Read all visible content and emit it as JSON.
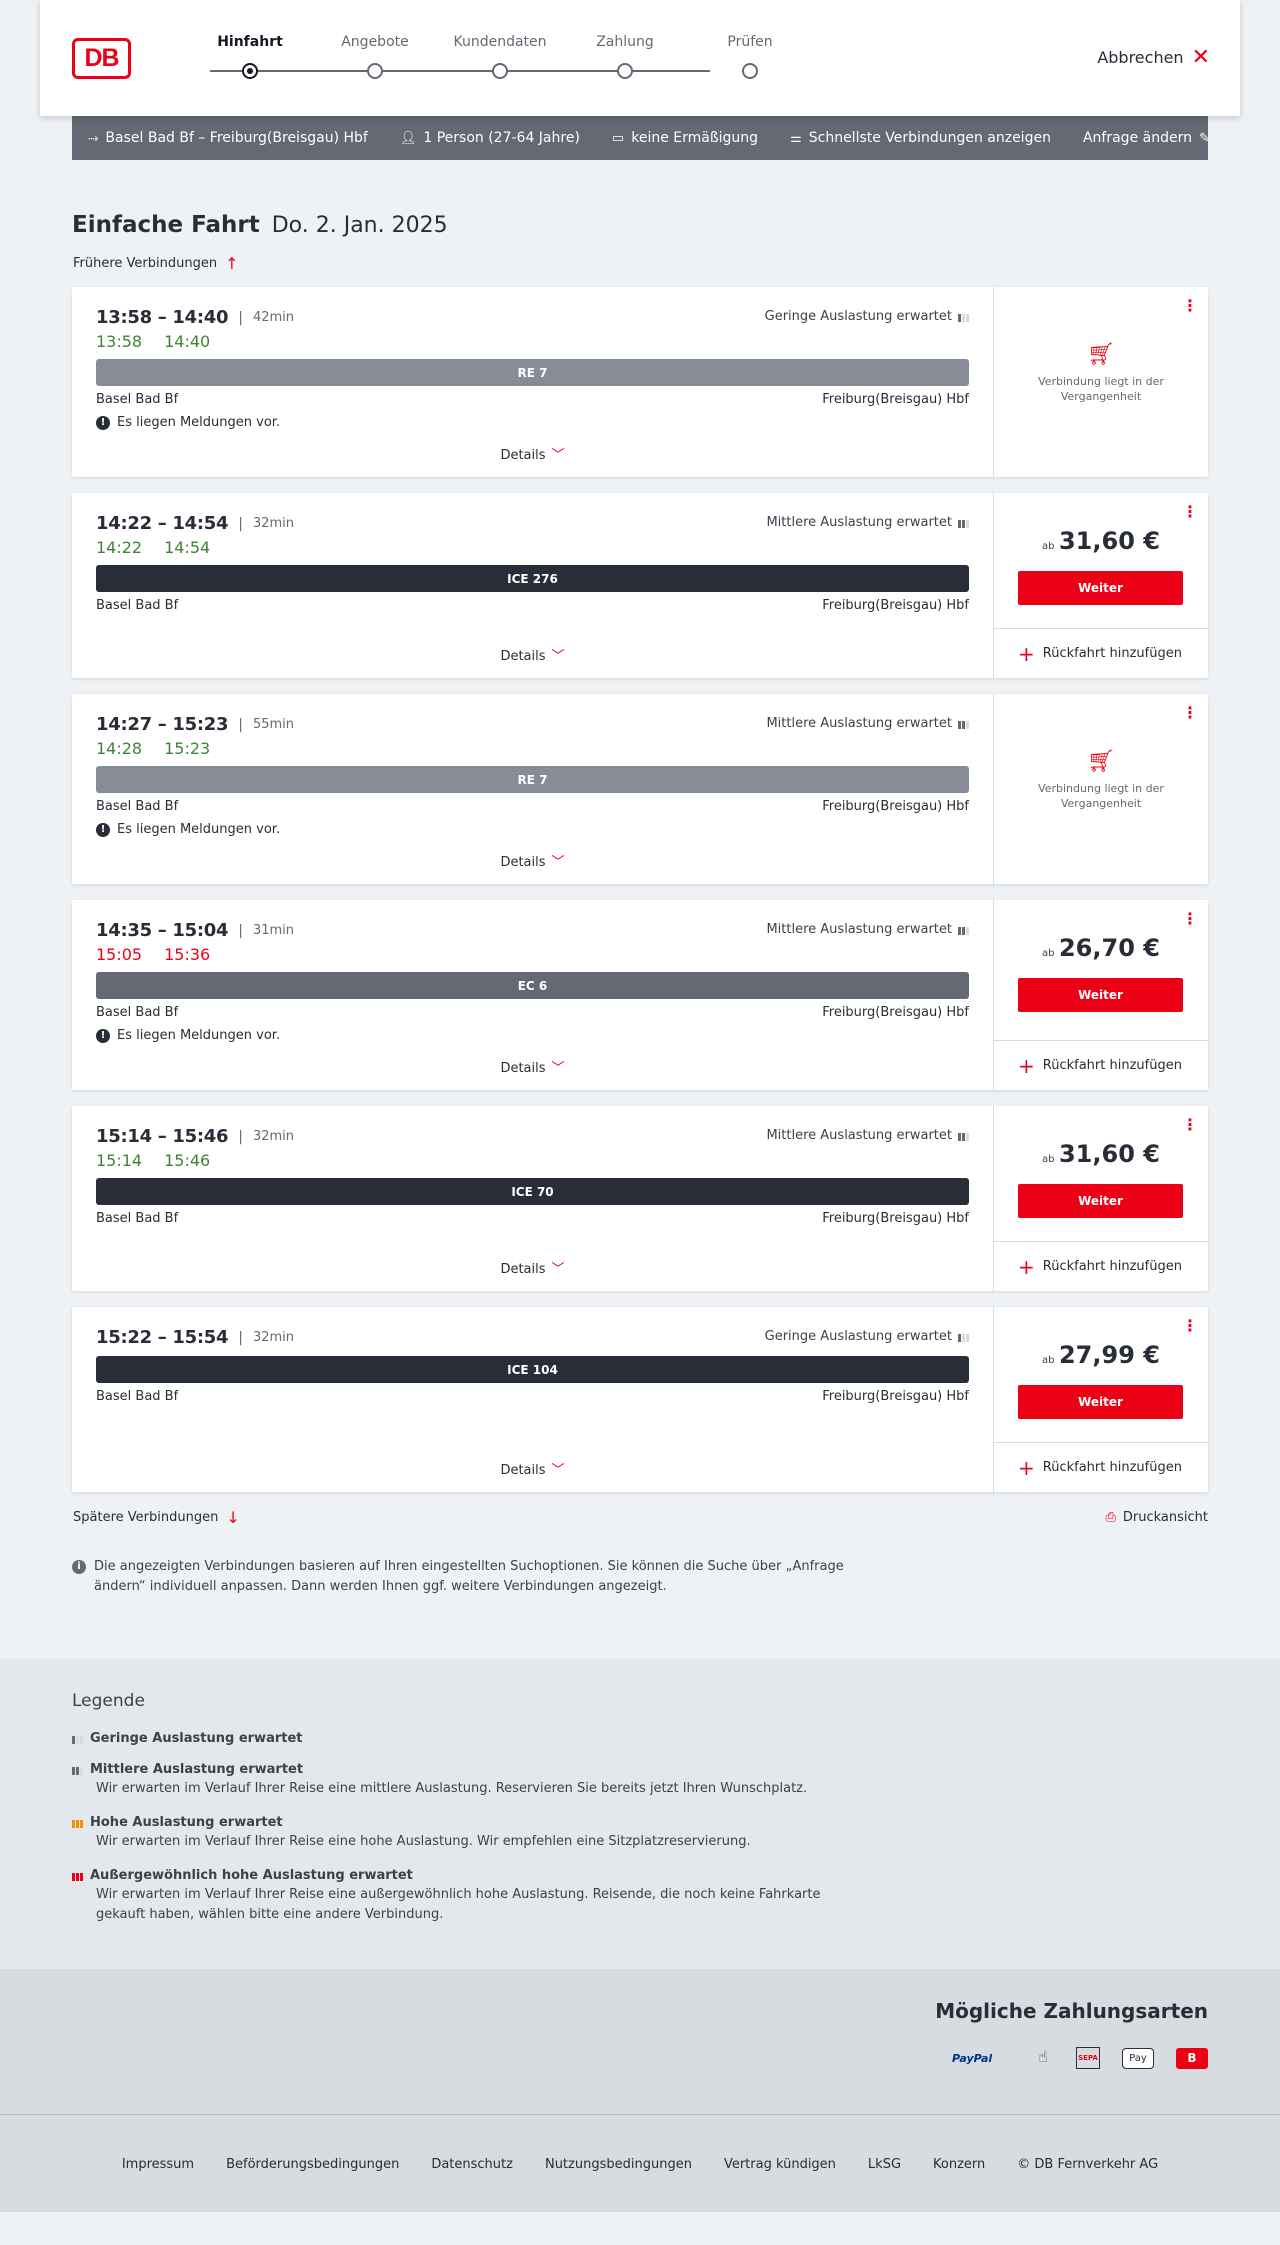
{
  "header": {
    "logo_text": "DB",
    "steps": [
      {
        "label": "Hinfahrt",
        "active": true
      },
      {
        "label": "Angebote",
        "active": false
      },
      {
        "label": "Kundendaten",
        "active": false
      },
      {
        "label": "Zahlung",
        "active": false
      },
      {
        "label": "Prüfen",
        "active": false
      }
    ],
    "cancel_label": "Abbrechen"
  },
  "search_summary": {
    "route": "Basel Bad Bf – Freiburg(Breisgau) Hbf",
    "travelers": "1 Person (27-64 Jahre)",
    "discount": "keine Ermäßigung",
    "option": "Schnellste Verbindungen anzeigen",
    "edit_label": "Anfrage ändern"
  },
  "main": {
    "trip_type": "Einfache Fahrt",
    "date": "Do. 2. Jan. 2025",
    "earlier_label": "Frühere Verbindungen",
    "later_label": "Spätere Verbindungen",
    "print_label": "Druckansicht",
    "info_text": "Die angezeigten Verbindungen basieren auf Ihren eingestellten Suchoptionen. Sie können die Suche über „Anfrage ändern“ individuell anpassen. Dann werden Ihnen ggf. weitere Verbindungen angezeigt.",
    "details_label": "Details",
    "past_label": "Verbindung liegt in der Vergangenheit",
    "price_prefix": "ab",
    "weiter_label": "Weiter",
    "return_label": "Rückfahrt hinzufügen",
    "notice_label": "Es liegen Meldungen vor."
  },
  "connections": [
    {
      "times": "13:58 – 14:40",
      "duration": "42min",
      "rt_dep": "13:58",
      "rt_arr": "14:40",
      "rt_status": "green",
      "load": "Geringe Auslastung erwartet",
      "load_level": "low",
      "train": "RE 7",
      "train_type": "re",
      "from": "Basel Bad Bf",
      "to": "Freiburg(Breisgau) Hbf",
      "notice": true,
      "past": true,
      "price": ""
    },
    {
      "times": "14:22 – 14:54",
      "duration": "32min",
      "rt_dep": "14:22",
      "rt_arr": "14:54",
      "rt_status": "green",
      "load": "Mittlere Auslastung erwartet",
      "load_level": "mid",
      "train": "ICE 276",
      "train_type": "ice",
      "from": "Basel Bad Bf",
      "to": "Freiburg(Breisgau) Hbf",
      "notice": false,
      "past": false,
      "price": "31,60 €"
    },
    {
      "times": "14:27 – 15:23",
      "duration": "55min",
      "rt_dep": "14:28",
      "rt_arr": "15:23",
      "rt_status": "green",
      "load": "Mittlere Auslastung erwartet",
      "load_level": "mid",
      "train": "RE 7",
      "train_type": "re",
      "from": "Basel Bad Bf",
      "to": "Freiburg(Breisgau) Hbf",
      "notice": true,
      "past": true,
      "price": ""
    },
    {
      "times": "14:35 – 15:04",
      "duration": "31min",
      "rt_dep": "15:05",
      "rt_arr": "15:36",
      "rt_status": "red",
      "load": "Mittlere Auslastung erwartet",
      "load_level": "mid",
      "train": "EC 6",
      "train_type": "ec",
      "from": "Basel Bad Bf",
      "to": "Freiburg(Breisgau) Hbf",
      "notice": true,
      "past": false,
      "price": "26,70 €"
    },
    {
      "times": "15:14 – 15:46",
      "duration": "32min",
      "rt_dep": "15:14",
      "rt_arr": "15:46",
      "rt_status": "green",
      "load": "Mittlere Auslastung erwartet",
      "load_level": "mid",
      "train": "ICE 70",
      "train_type": "ice",
      "from": "Basel Bad Bf",
      "to": "Freiburg(Breisgau) Hbf",
      "notice": false,
      "past": false,
      "price": "31,60 €"
    },
    {
      "times": "15:22 – 15:54",
      "duration": "32min",
      "rt_dep": "",
      "rt_arr": "",
      "rt_status": "none",
      "load": "Geringe Auslastung erwartet",
      "load_level": "low",
      "train": "ICE 104",
      "train_type": "ice",
      "from": "Basel Bad Bf",
      "to": "Freiburg(Breisgau) Hbf",
      "notice": false,
      "past": false,
      "price": "27,99 €"
    }
  ],
  "legend": {
    "title": "Legende",
    "items": [
      {
        "level": "low",
        "title": "Geringe Auslastung erwartet",
        "text": ""
      },
      {
        "level": "mid",
        "title": "Mittlere Auslastung erwartet",
        "text": "Wir erwarten im Verlauf Ihrer Reise eine mittlere Auslastung. Reservieren Sie bereits jetzt Ihren Wunschplatz."
      },
      {
        "level": "high",
        "title": "Hohe Auslastung erwartet",
        "text": "Wir erwarten im Verlauf Ihrer Reise eine hohe Auslastung. Wir empfehlen eine Sitzplatzreservierung."
      },
      {
        "level": "extreme",
        "title": "Außergewöhnlich hohe Auslastung erwartet",
        "text": "Wir erwarten im Verlauf Ihrer Reise eine außergewöhnlich hohe Auslastung. Reisende, die noch keine Fahrkarte gekauft haben, wählen bitte eine andere Verbindung."
      }
    ]
  },
  "payment": {
    "title": "Mögliche Zahlungsarten",
    "methods": [
      {
        "name": "paypal",
        "label": "PayPal"
      },
      {
        "name": "google-pay",
        "label": ""
      },
      {
        "name": "sepa",
        "label": "SEPA"
      },
      {
        "name": "apple-pay",
        "label": "Pay"
      },
      {
        "name": "db",
        "label": "B"
      }
    ]
  },
  "footer": {
    "links": [
      "Impressum",
      "Beförderungsbedingungen",
      "Datenschutz",
      "Nutzungsbedingungen",
      "Vertrag kündigen",
      "LkSG",
      "Konzern",
      "© DB Fernverkehr AG"
    ]
  },
  "colors": {
    "accent": "#ec0016",
    "on_time": "#408335",
    "delayed": "#ec0016",
    "summary_bar": "#646973"
  }
}
